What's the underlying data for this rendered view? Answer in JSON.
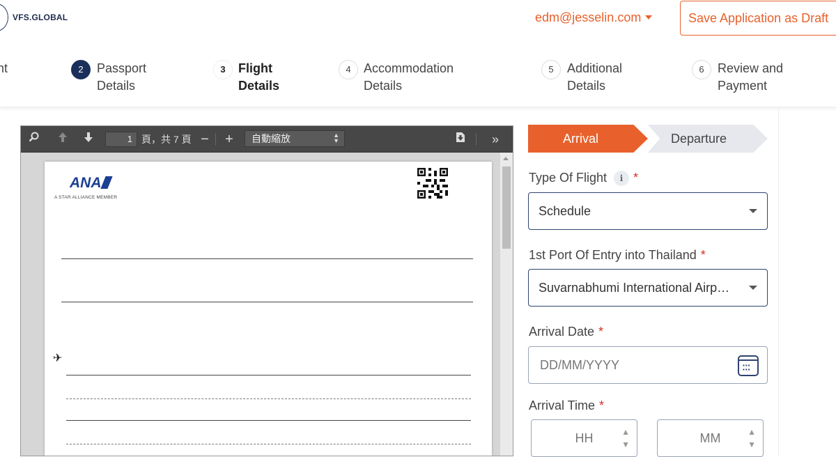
{
  "header": {
    "logo_text": "VFS.GLOBAL",
    "user_email": "edm@jesselin.com",
    "save_draft_label": "Save Application as Draft"
  },
  "stepper": {
    "steps": [
      {
        "number": "",
        "label_line1": "nt",
        "label_line2": ""
      },
      {
        "number": "2",
        "label_line1": "Passport",
        "label_line2": "Details"
      },
      {
        "number": "3",
        "label_line1": "Flight",
        "label_line2": "Details"
      },
      {
        "number": "4",
        "label_line1": "Accommodation",
        "label_line2": "Details"
      },
      {
        "number": "5",
        "label_line1": "Additional",
        "label_line2": "Details"
      },
      {
        "number": "6",
        "label_line1": "Review and",
        "label_line2": "Payment"
      }
    ]
  },
  "viewer": {
    "page_number": "1",
    "page_count_text": "頁，共 7 頁",
    "zoom_label": "自動縮放",
    "document": {
      "airline_logo": "ANA",
      "airline_tagline": "A STAR ALLIANCE MEMBER"
    }
  },
  "form": {
    "tabs": {
      "arrival": "Arrival",
      "departure": "Departure"
    },
    "type_of_flight": {
      "label": "Type Of Flight",
      "info": "i",
      "value": "Schedule"
    },
    "port_of_entry": {
      "label": "1st Port Of Entry into Thailand",
      "value": "Suvarnabhumi International Airp…"
    },
    "arrival_date": {
      "label": "Arrival Date",
      "placeholder": "DD/MM/YYYY"
    },
    "arrival_time": {
      "label": "Arrival Time",
      "hour_placeholder": "HH",
      "minute_placeholder": "MM"
    },
    "required_mark": "*"
  },
  "colors": {
    "accent": "#e8612c",
    "navy": "#1a2f5a",
    "tab_inactive": "#e6e8ee",
    "required": "#d93025"
  }
}
